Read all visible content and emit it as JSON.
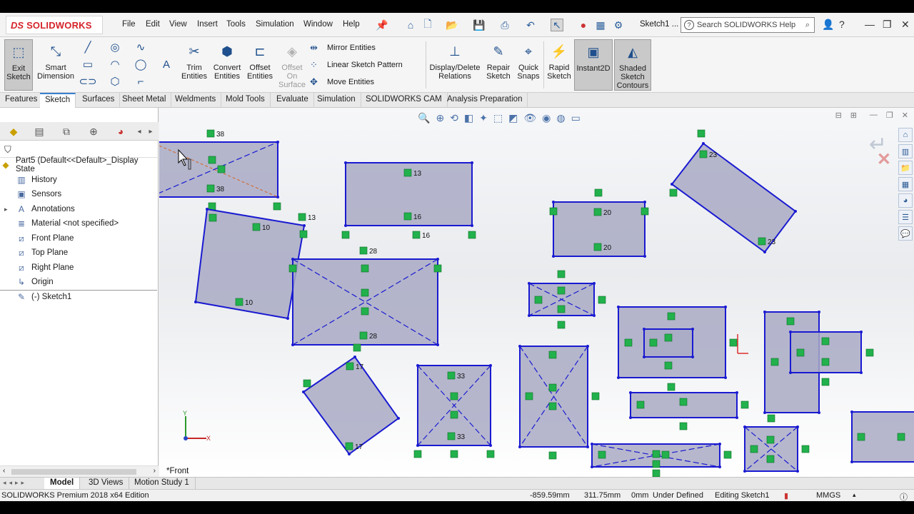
{
  "app": {
    "logo_text": "SOLIDWORKS",
    "logo_mark": "DS"
  },
  "menu": [
    "File",
    "Edit",
    "View",
    "Insert",
    "Tools",
    "Simulation",
    "Window",
    "Help"
  ],
  "document_title": "Sketch1 ...",
  "search": {
    "placeholder": "Search SOLIDWORKS Help"
  },
  "ribbon": {
    "exit_sketch": "Exit Sketch",
    "smart_dimension": "Smart Dimension",
    "trim_entities": "Trim Entities",
    "convert_entities": "Convert Entities",
    "offset_entities": "Offset Entities",
    "offset_on_surface": "Offset On Surface",
    "mirror_entities": "Mirror Entities",
    "linear_sketch_pattern": "Linear Sketch Pattern",
    "move_entities": "Move Entities",
    "display_delete_relations": "Display/Delete Relations",
    "repair_sketch": "Repair Sketch",
    "quick_snaps": "Quick Snaps",
    "rapid_sketch": "Rapid Sketch",
    "instant2d": "Instant2D",
    "shaded_sketch_contours": "Shaded Sketch Contours"
  },
  "tabs": [
    "Features",
    "Sketch",
    "Surfaces",
    "Sheet Metal",
    "Weldments",
    "Mold Tools",
    "Evaluate",
    "Simulation",
    "SOLIDWORKS CAM",
    "Analysis Preparation"
  ],
  "active_tab": "Sketch",
  "tree": {
    "root": "Part5  (Default<<Default>_Display State",
    "items": [
      "History",
      "Sensors",
      "Annotations",
      "Material <not specified>",
      "Front Plane",
      "Top Plane",
      "Right Plane",
      "Origin",
      "(-) Sketch1"
    ]
  },
  "viewport": {
    "view_name": "*Front",
    "relation_labels": [
      "38",
      "38",
      "13",
      "16",
      "13",
      "16",
      "10",
      "10",
      "28",
      "28",
      "20",
      "20",
      "23",
      "23",
      "17",
      "17",
      "33",
      "33"
    ]
  },
  "bottom_tabs": [
    "Model",
    "3D Views",
    "Motion Study 1"
  ],
  "status": {
    "edition": "SOLIDWORKS Premium 2018 x64 Edition",
    "x": "-859.59mm",
    "y": "311.75mm",
    "z": "0mm",
    "state": "Under Defined",
    "mode": "Editing Sketch1",
    "units": "MMGS"
  },
  "colors": {
    "accent": "#d5232a",
    "sketch_line": "#1a1ad1",
    "fill": "#a9aac4",
    "relation": "#22b14c"
  }
}
